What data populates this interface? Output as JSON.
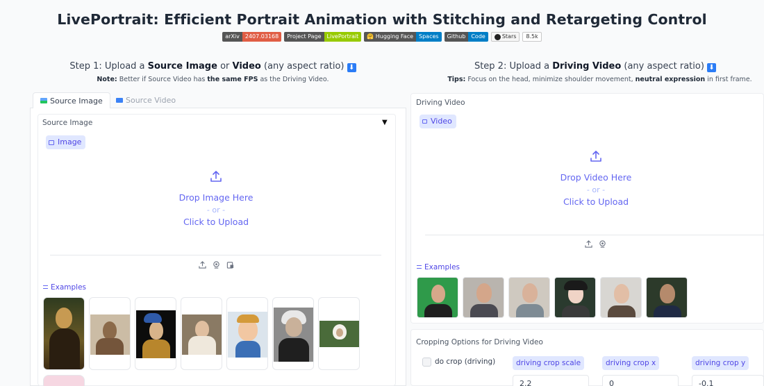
{
  "title": "LivePortrait: Efficient Portrait Animation with Stitching and Retargeting Control",
  "badges": [
    {
      "left": "arXiv",
      "right": "2407.03168",
      "color": "#e05d44"
    },
    {
      "left": "Project Page",
      "right": "LivePortrait",
      "color": "#97ca00"
    },
    {
      "left": "🤗 Hugging Face",
      "right": "Spaces",
      "color": "#007ec6"
    },
    {
      "left": "Github",
      "right": "Code",
      "color": "#007ec6"
    }
  ],
  "stars": {
    "label": "Stars",
    "count": "8.5k"
  },
  "step1": {
    "prefix": "Step 1: Upload a ",
    "bold1": "Source Image",
    "mid": " or ",
    "bold2": "Video",
    "suffix": " (any aspect ratio) ",
    "note_label": "Note:",
    "note_text": " Better if Source Video has ",
    "note_bold": "the same FPS",
    "note_end": " as the Driving Video."
  },
  "step2": {
    "prefix": "Step 2: Upload a ",
    "bold1": "Driving Video",
    "suffix": " (any aspect ratio) ",
    "tips_label": "Tips:",
    "tips_text": " Focus on the head, minimize shoulder movement, ",
    "tips_bold": "neutral expression",
    "tips_end": " in first frame."
  },
  "left_tabs": [
    "Source Image",
    "Source Video"
  ],
  "source_image": {
    "label": "Source Image",
    "pill": "Image",
    "drop": "Drop Image Here",
    "or": "- or -",
    "click": "Click to Upload",
    "examples_label": "Examples",
    "examples": [
      "mona-lisa",
      "terracotta-warrior",
      "girl-with-pearl-earring",
      "child-portrait",
      "cartoon-boy",
      "einstein",
      "monkey"
    ]
  },
  "driving_video": {
    "label": "Driving Video",
    "pill": "Video",
    "drop": "Drop Video Here",
    "or": "- or -",
    "click": "Click to Upload",
    "examples_label": "Examples",
    "examples": [
      "man-green-bg",
      "man-1",
      "man-2",
      "woman-1",
      "woman-2",
      "man-3"
    ]
  },
  "cropping": {
    "label": "Cropping Options for Driving Video",
    "do_crop": "do crop (driving)",
    "scale_label": "driving crop scale",
    "scale_value": "2.2",
    "x_label": "driving crop x",
    "x_value": "0",
    "y_label": "driving crop y",
    "y_value": "-0.1"
  },
  "colors": {
    "accent": "#6366f1",
    "accent_bg": "#e0e7ff"
  }
}
